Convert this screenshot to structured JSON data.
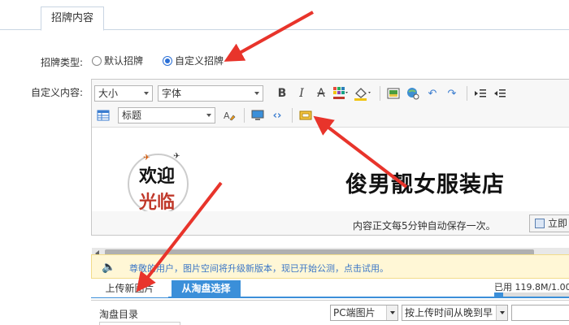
{
  "top_tab": {
    "label": "招牌内容"
  },
  "signboard_type": {
    "label": "招牌类型:",
    "options": [
      {
        "label": "默认招牌",
        "checked": false
      },
      {
        "label": "自定义招牌",
        "checked": true
      }
    ]
  },
  "custom_content": {
    "label": "自定义内容:"
  },
  "toolbar": {
    "size_select": "大小",
    "font_select": "字体",
    "heading_select": "标题",
    "bold": "B",
    "italic": "I",
    "strike": "A"
  },
  "editor_content": {
    "welcome_line1": "欢迎",
    "welcome_line2": "光临",
    "store_name": "俊男靓女服装店"
  },
  "autosave": {
    "text": "内容正文每5分钟自动保存一次。",
    "save_button": "立即"
  },
  "notice": {
    "text": "尊敬的用户，图片空间将升级新版本，现已开始公测，点击试用。"
  },
  "upload_tabs": {
    "upload_new": "上传新图片",
    "from_taopan": "从淘盘选择"
  },
  "usage": {
    "text": "已用 119.8M/1.00",
    "fraction": 0.12
  },
  "picker": {
    "dir_label": "淘盘目录",
    "source_select": "PC端图片",
    "sort_select": "按上传时间从晚到早"
  },
  "colors": {
    "accent": "#3b8fd9",
    "arrow": "#e8342b"
  }
}
